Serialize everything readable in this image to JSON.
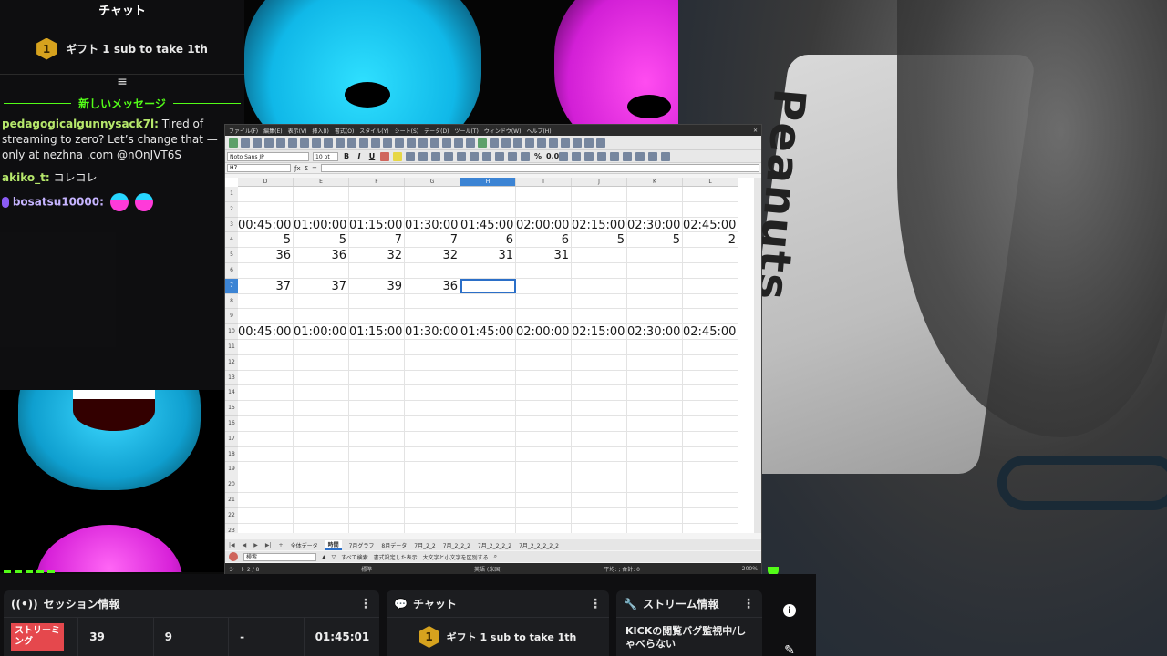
{
  "chat_overlay": {
    "title": "チャット",
    "gift_badge": "1",
    "gift_text": "ギフト 1 sub to take 1th",
    "new_messages_label": "新しいメッセージ",
    "messages": [
      {
        "user": "pedagogicalgunnysack7l:",
        "text": "Tired of streaming to zero? Let’s change that — only at nezhna .com @nOnJVT6S"
      },
      {
        "user": "akiko_t:",
        "text": "コレコレ"
      },
      {
        "user": "bosatsu10000:",
        "text": ""
      }
    ]
  },
  "spreadsheet": {
    "menu": [
      "ファイル(F)",
      "編集(E)",
      "表示(V)",
      "挿入(I)",
      "書式(O)",
      "スタイル(Y)",
      "シート(S)",
      "データ(D)",
      "ツール(T)",
      "ウィンドウ(W)",
      "ヘルプ(H)"
    ],
    "font_name": "Noto Sans JP",
    "font_size": "10 pt",
    "name_box": "H7",
    "columns": [
      "D",
      "E",
      "F",
      "G",
      "H",
      "I",
      "J",
      "K",
      "L"
    ],
    "selected_column": "H",
    "rows": [
      "1",
      "2",
      "3",
      "4",
      "5",
      "6",
      "7",
      "8",
      "9",
      "10",
      "11",
      "12",
      "13",
      "14",
      "15",
      "16",
      "17",
      "18",
      "19",
      "20",
      "21",
      "22",
      "23"
    ],
    "selected_row": "7",
    "cells": {
      "r3": [
        "00:45:00",
        "01:00:00",
        "01:15:00",
        "01:30:00",
        "01:45:00",
        "02:00:00",
        "02:15:00",
        "02:30:00",
        "02:45:00"
      ],
      "r4": [
        "5",
        "5",
        "7",
        "7",
        "6",
        "6",
        "5",
        "5",
        "2"
      ],
      "r5": [
        "36",
        "36",
        "32",
        "32",
        "31",
        "31",
        "",
        "",
        ""
      ],
      "r7": [
        "37",
        "37",
        "39",
        "36",
        "",
        "",
        "",
        "",
        ""
      ],
      "r10": [
        "00:45:00",
        "01:00:00",
        "01:15:00",
        "01:30:00",
        "01:45:00",
        "02:00:00",
        "02:15:00",
        "02:30:00",
        "02:45:00"
      ]
    },
    "sheet_tabs": [
      "全体データ",
      "時間",
      "7月グラフ",
      "8月データ",
      "7月_2_2",
      "7月_2_2_2",
      "7月_2_2_2_2",
      "7月_2_2_2_2_2"
    ],
    "selected_tab": "時間",
    "find_placeholder": "検索",
    "find_options": [
      "すべて検索",
      "書式設定した表示",
      "大文字と小文字を区別する"
    ],
    "status_sheet": "シート 2 / 8",
    "status_style": "標準",
    "status_lang": "英語 (米国)",
    "status_sum": "平均: ; 合計: 0",
    "zoom": "200%"
  },
  "dashboard": {
    "session": {
      "title": "セッション情報",
      "live_label": "ストリーミング",
      "viewers": "39",
      "followers": "9",
      "subs": "-",
      "uptime": "01:45:01"
    },
    "chat": {
      "title": "チャット",
      "gift_badge": "1",
      "gift_text": "ギフト 1 sub to take 1th"
    },
    "stream": {
      "title": "ストリーム情報",
      "stream_title": "KICKの閲覧バグ監視中/しゃべらない"
    }
  },
  "camera": {
    "shirt_text": "Peanuts"
  }
}
